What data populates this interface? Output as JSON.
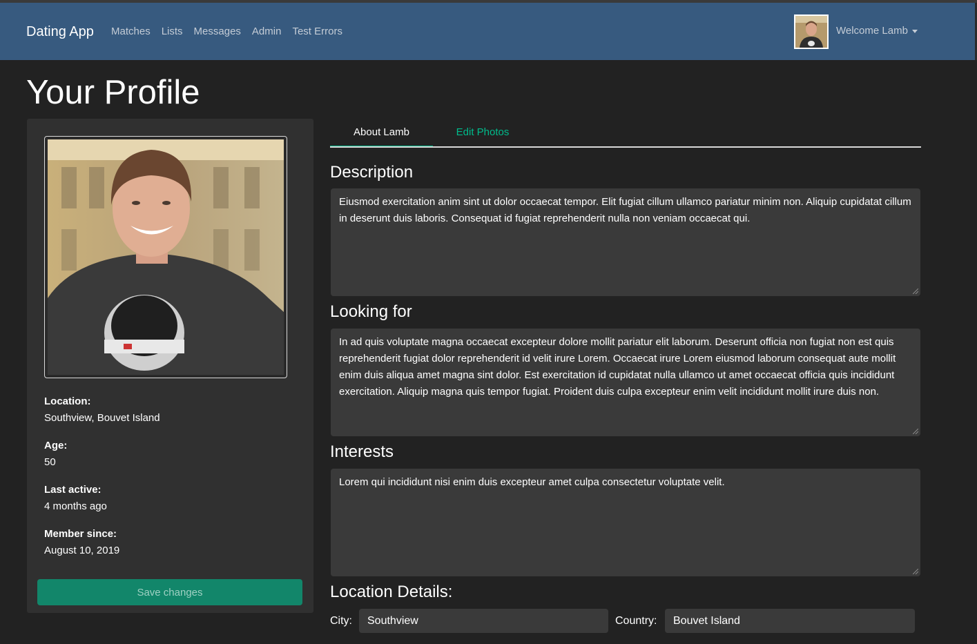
{
  "navbar": {
    "brand": "Dating App",
    "links": [
      "Matches",
      "Lists",
      "Messages",
      "Admin",
      "Test Errors"
    ],
    "welcome": "Welcome Lamb",
    "avatar_icon": "user-avatar"
  },
  "page": {
    "title": "Your Profile"
  },
  "profile_card": {
    "location_label": "Location:",
    "location_value": "Southview, Bouvet Island",
    "age_label": "Age:",
    "age_value": "50",
    "last_active_label": "Last active:",
    "last_active_value": "4 months ago",
    "member_since_label": "Member since:",
    "member_since_value": "August 10, 2019",
    "save_label": "Save changes"
  },
  "tabs": [
    {
      "label": "About Lamb",
      "active": true
    },
    {
      "label": "Edit Photos",
      "active": false
    }
  ],
  "about": {
    "description_title": "Description",
    "description_text": "Eiusmod exercitation anim sint ut dolor occaecat tempor. Elit fugiat cillum ullamco pariatur minim non. Aliquip cupidatat cillum in deserunt duis laboris. Consequat id fugiat reprehenderit nulla non veniam occaecat qui.",
    "looking_for_title": "Looking for",
    "looking_for_text": "In ad quis voluptate magna occaecat excepteur dolore mollit pariatur elit laborum. Deserunt officia non fugiat non est quis reprehenderit fugiat dolor reprehenderit id velit irure Lorem. Occaecat irure Lorem eiusmod laborum consequat aute mollit enim duis aliqua amet magna sint dolor. Est exercitation id cupidatat nulla ullamco ut amet occaecat officia quis incididunt exercitation. Aliquip magna quis tempor fugiat. Proident duis culpa excepteur enim velit incididunt mollit irure duis non.",
    "interests_title": "Interests",
    "interests_text": "Lorem qui incididunt nisi enim duis excepteur amet culpa consectetur voluptate velit.",
    "location_details_title": "Location Details:",
    "city_label": "City:",
    "city_value": "Southview",
    "country_label": "Country:",
    "country_value": "Bouvet Island"
  },
  "colors": {
    "navbar": "#375a7f",
    "background": "#222222",
    "card": "#303030",
    "accent": "#00bc8c",
    "button": "#12866a"
  }
}
